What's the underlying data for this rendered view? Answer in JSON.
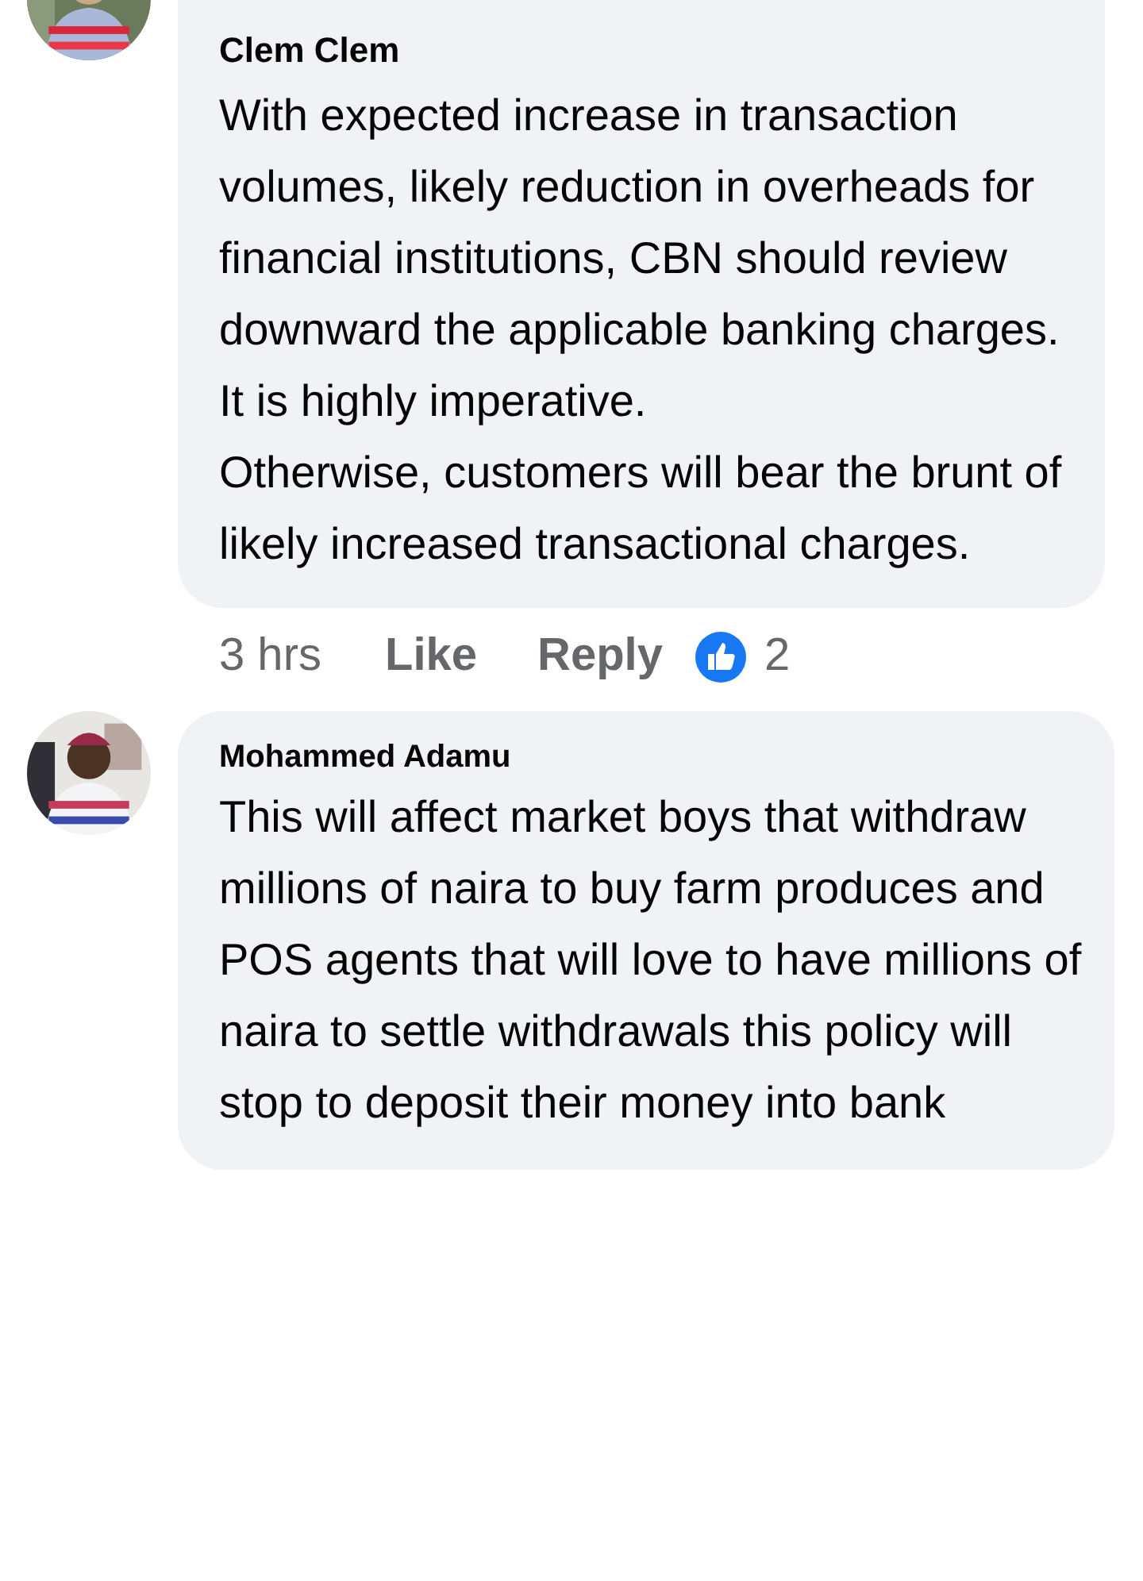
{
  "comments": [
    {
      "author": "Clem Clem",
      "text": "With expected increase in transaction volumes, likely reduction in overheads for financial institutions, CBN should review downward the applicable banking charges.\nIt is highly imperative.\nOtherwise, customers will bear the brunt of  likely increased transactional charges.",
      "meta": {
        "time": "3 hrs",
        "like": "Like",
        "reply": "Reply",
        "reaction_count": "2"
      }
    },
    {
      "author": "Mohammed Adamu",
      "text": "This will affect market boys that withdraw millions of naira to buy farm produces and POS agents that will love to have millions of naira to settle withdrawals this policy will stop to deposit their money into bank"
    }
  ]
}
